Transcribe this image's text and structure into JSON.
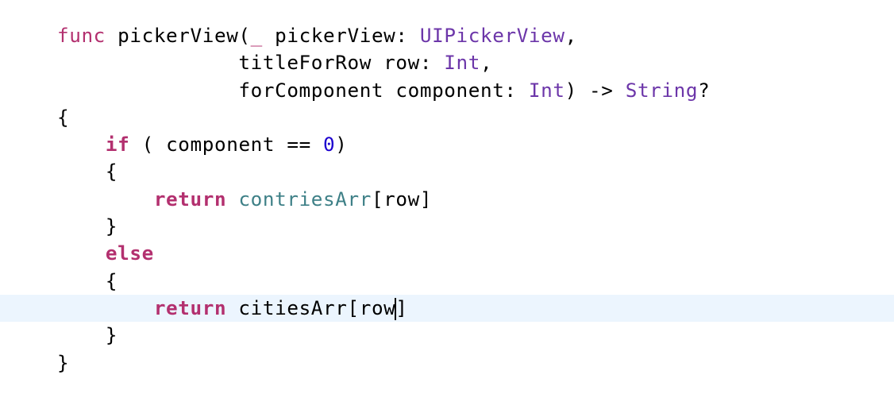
{
  "editor": {
    "lines": [
      {
        "tokens": [
          {
            "text": "func",
            "kind": "kw-light"
          },
          {
            "text": " pickerView(",
            "kind": "plain"
          },
          {
            "text": "_",
            "kind": "kw-light"
          },
          {
            "text": " pickerView: ",
            "kind": "plain"
          },
          {
            "text": "UIPickerView",
            "kind": "type"
          },
          {
            "text": ",",
            "kind": "plain"
          }
        ]
      },
      {
        "tokens": [
          {
            "text": "               titleForRow row: ",
            "kind": "plain"
          },
          {
            "text": "Int",
            "kind": "type"
          },
          {
            "text": ",",
            "kind": "plain"
          }
        ]
      },
      {
        "tokens": [
          {
            "text": "               forComponent component: ",
            "kind": "plain"
          },
          {
            "text": "Int",
            "kind": "type"
          },
          {
            "text": ") -> ",
            "kind": "plain"
          },
          {
            "text": "String",
            "kind": "type"
          },
          {
            "text": "?",
            "kind": "plain"
          }
        ]
      },
      {
        "tokens": [
          {
            "text": "{",
            "kind": "plain"
          }
        ]
      },
      {
        "tokens": [
          {
            "text": "    ",
            "kind": "plain"
          },
          {
            "text": "if",
            "kind": "kw"
          },
          {
            "text": " ( component == ",
            "kind": "plain"
          },
          {
            "text": "0",
            "kind": "num"
          },
          {
            "text": ")",
            "kind": "plain"
          }
        ]
      },
      {
        "tokens": [
          {
            "text": "    {",
            "kind": "plain"
          }
        ]
      },
      {
        "tokens": [
          {
            "text": "        ",
            "kind": "plain"
          },
          {
            "text": "return",
            "kind": "kw"
          },
          {
            "text": " ",
            "kind": "plain"
          },
          {
            "text": "contriesArr",
            "kind": "ivar"
          },
          {
            "text": "[row]",
            "kind": "plain"
          }
        ]
      },
      {
        "tokens": [
          {
            "text": "    }",
            "kind": "plain"
          }
        ]
      },
      {
        "tokens": [
          {
            "text": "    ",
            "kind": "plain"
          },
          {
            "text": "else",
            "kind": "kw"
          }
        ]
      },
      {
        "tokens": [
          {
            "text": "    {",
            "kind": "plain"
          }
        ]
      },
      {
        "current": true,
        "tokens": [
          {
            "text": "        ",
            "kind": "plain"
          },
          {
            "text": "return",
            "kind": "kw"
          },
          {
            "text": " citiesArr[row",
            "kind": "plain"
          },
          {
            "caret": true
          },
          {
            "text": "]",
            "kind": "plain"
          }
        ]
      },
      {
        "tokens": [
          {
            "text": "    }",
            "kind": "plain"
          }
        ]
      },
      {
        "tokens": [
          {
            "text": "}",
            "kind": "plain"
          }
        ]
      }
    ]
  },
  "colors": {
    "keyword": "#b3306f",
    "type": "#6c36a9",
    "number": "#1c00cf",
    "instance_variable": "#3e8087",
    "plain": "#000000",
    "current_line_highlight": "#ecf5fe",
    "background": "#ffffff"
  }
}
